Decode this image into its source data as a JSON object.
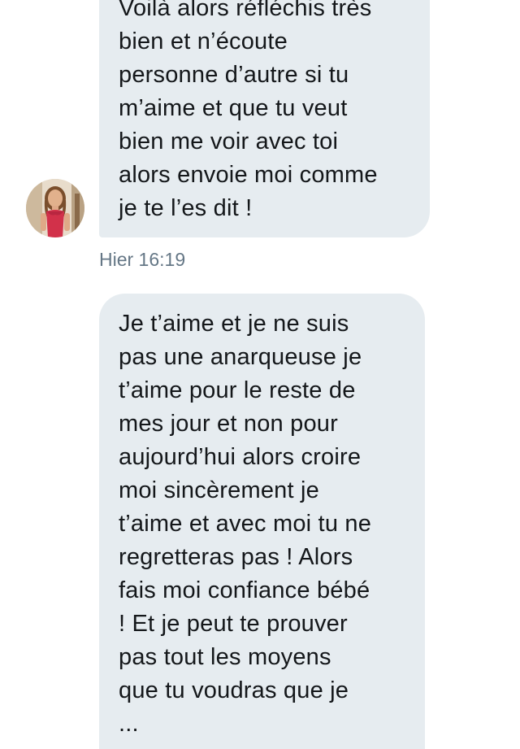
{
  "conversation": {
    "message_1": {
      "lines": [
        "Voilà alors réfléchis très",
        "bien et n’écoute",
        "personne d’autre si tu",
        "m’aime et que tu veut",
        "bien me voir avec toi",
        "alors envoie moi comme",
        "je te l’es dit !"
      ]
    },
    "timestamp": "Hier 16:19",
    "message_2": {
      "lines": [
        "Je t’aime et je ne suis",
        "pas une anarqueuse je",
        "t’aime pour le reste de",
        "mes jour et non pour",
        "aujourd’hui alors croire",
        "moi sincèrement je",
        "t’aime et avec moi tu ne",
        "regretteras pas ! Alors",
        "fais moi confiance bébé",
        "! Et je peut te prouver",
        "pas tout les moyens",
        "que tu voudras que je",
        "..."
      ]
    }
  },
  "colors": {
    "bubble_background": "#e6ecf0",
    "message_text": "#14171a",
    "timestamp_text": "#657786",
    "page_background": "#ffffff"
  },
  "icons": {
    "avatar": "sender-profile-photo"
  }
}
